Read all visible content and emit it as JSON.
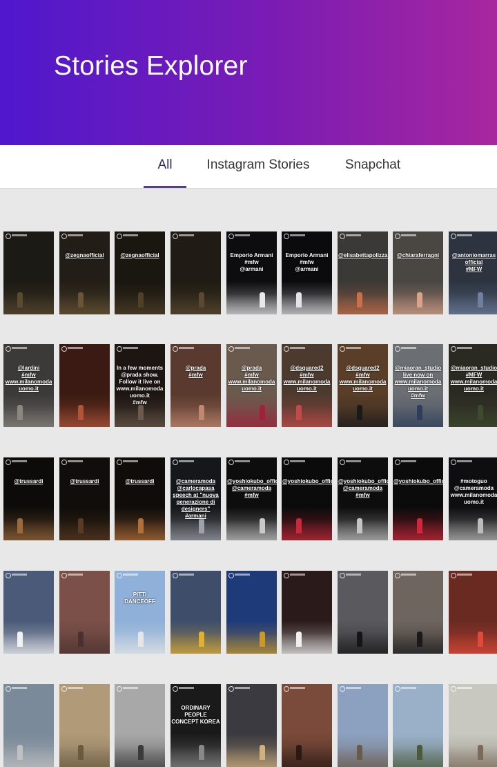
{
  "header": {
    "title": "Stories Explorer"
  },
  "tabs": [
    {
      "label": "All",
      "active": true
    },
    {
      "label": "Instagram Stories",
      "active": false
    },
    {
      "label": "Snapchat",
      "active": false
    }
  ],
  "rows": [
    [
      {
        "caption": "",
        "bg": "#1c1a14",
        "accent": "#5a4a30"
      },
      {
        "caption": "@zegnaofficial",
        "bg": "#221d16",
        "accent": "#6a5636"
      },
      {
        "caption": "@zegnaofficial",
        "bg": "#1a1610",
        "accent": "#4f4028"
      },
      {
        "caption": "",
        "bg": "#201b14",
        "accent": "#5b4a31"
      },
      {
        "caption": "Emporio Armani\n#mfw\n@armani",
        "bg": "#0d0d0f",
        "accent": "#e9e9ec"
      },
      {
        "caption": "Emporio Armani\n#mfw\n@armani",
        "bg": "#0b0b0d",
        "accent": "#e4e4e8"
      },
      {
        "caption": "@elisabettapolizzani",
        "bg": "#3a3936",
        "accent": "#c9704a"
      },
      {
        "caption": "@chiaraferragni",
        "bg": "#4a4743",
        "accent": "#d9a28a"
      },
      {
        "caption": "@antoniomarras\nofficial\n#MFW",
        "bg": "#2d3440",
        "accent": "#6e7fa0"
      }
    ],
    [
      {
        "caption": "@lardini\n#mfw\nwww.milanomoda\nuomo.it",
        "bg": "#3b3a39",
        "accent": "#8a8680"
      },
      {
        "caption": "",
        "bg": "#3a1a12",
        "accent": "#b0553a"
      },
      {
        "caption": "In a few moments\n@prada show.\nFollow it live on\nwww.milanomoda\nuomo.it\n#mfw",
        "bg": "#1d1512",
        "accent": "#6b5a4d"
      },
      {
        "caption": "@prada\n#mfw",
        "bg": "#5a3a2e",
        "accent": "#c08870"
      },
      {
        "caption": "@prada\n#mfw\nwww.milanomoda\nuomo.it",
        "bg": "#6a5a4e",
        "accent": "#a0223a"
      },
      {
        "caption": "@dsquared2\n#mfw\nwww.milanomoda\nuomo.it",
        "bg": "#4d3a2e",
        "accent": "#c24a4a"
      },
      {
        "caption": "@dsquared2\n#mfw\nwww.milanomoda\nuomo.it",
        "bg": "#5a3e28",
        "accent": "#1a1a1a"
      },
      {
        "caption": "@miaoran_studio\nlive now on\nwww.milanomoda\nuomo.it\n#mfw",
        "bg": "#6b6e73",
        "accent": "#2d3e5a"
      },
      {
        "caption": "@miaoran_studio\n#MFW\nwww.milanomoda\nuomo.it",
        "bg": "#2b2a22",
        "accent": "#3d4a2e"
      }
    ],
    [
      {
        "caption": "@trussardi",
        "bg": "#0d0b09",
        "accent": "#9a6a3e"
      },
      {
        "caption": "@trussardi",
        "bg": "#100d0a",
        "accent": "#5a3a22"
      },
      {
        "caption": "@trussardi",
        "bg": "#0f0c0a",
        "accent": "#b0703a"
      },
      {
        "caption": "@cameramoda\n@carlocapasa\nspeech at \"nuova\ngenerazione di designers\"\n#armani",
        "bg": "#15171a",
        "accent": "#9ea3aa"
      },
      {
        "caption": "@yoshiokubo_official\n@cameramoda\n#mfw",
        "bg": "#0d0d0e",
        "accent": "#c9c9c9"
      },
      {
        "caption": "@yoshiokubo_official",
        "bg": "#0b0b0c",
        "accent": "#c92a3a"
      },
      {
        "caption": "@yoshiokubo_official\n@cameramoda\n#mfw",
        "bg": "#0d0d0e",
        "accent": "#c4c4c4"
      },
      {
        "caption": "@yoshiokubo_official",
        "bg": "#0c0b0c",
        "accent": "#d0283a"
      },
      {
        "caption": "#motoguo\n@cameramoda\nwww.milanomoda\nuomo.it",
        "bg": "#0e0e10",
        "accent": "#bcbcbc"
      }
    ],
    [
      {
        "caption": "",
        "bg": "#4a5a78",
        "accent": "#f2f2f2"
      },
      {
        "caption": "",
        "bg": "#7a5048",
        "accent": "#4a3030"
      },
      {
        "caption": "PITTI\nDANCEOFF",
        "bg": "#8fb0d8",
        "accent": "#e6e6e6"
      },
      {
        "caption": "",
        "bg": "#3e4e6a",
        "accent": "#e2b030"
      },
      {
        "caption": "",
        "bg": "#1e3a78",
        "accent": "#c99a2a"
      },
      {
        "caption": "",
        "bg": "#2a1a1a",
        "accent": "#f0f0f0"
      },
      {
        "caption": "",
        "bg": "#5a5a5e",
        "accent": "#151515"
      },
      {
        "caption": "",
        "bg": "#6e655e",
        "accent": "#1a1a1a"
      },
      {
        "caption": "",
        "bg": "#6a2a22",
        "accent": "#e04a3a"
      }
    ],
    [
      {
        "caption": "",
        "bg": "#7a8a9a",
        "accent": "#c0c0c0"
      },
      {
        "caption": "",
        "bg": "#b09a78",
        "accent": "#6a5a40"
      },
      {
        "caption": "",
        "bg": "#a8a8a8",
        "accent": "#3a3a3a"
      },
      {
        "caption": "ORDINARY PEOPLE\nCONCEPT KOREA",
        "bg": "#1a1a1a",
        "accent": "#888888"
      },
      {
        "caption": "",
        "bg": "#3a3a40",
        "accent": "#d0b080"
      },
      {
        "caption": "",
        "bg": "#7a4a3a",
        "accent": "#2a1a14"
      },
      {
        "caption": "",
        "bg": "#8ca0c0",
        "accent": "#6a5a4a"
      },
      {
        "caption": "",
        "bg": "#9ab0c8",
        "accent": "#4a5a3a"
      },
      {
        "caption": "",
        "bg": "#c8c8c0",
        "accent": "#7a6a5a"
      }
    ]
  ]
}
